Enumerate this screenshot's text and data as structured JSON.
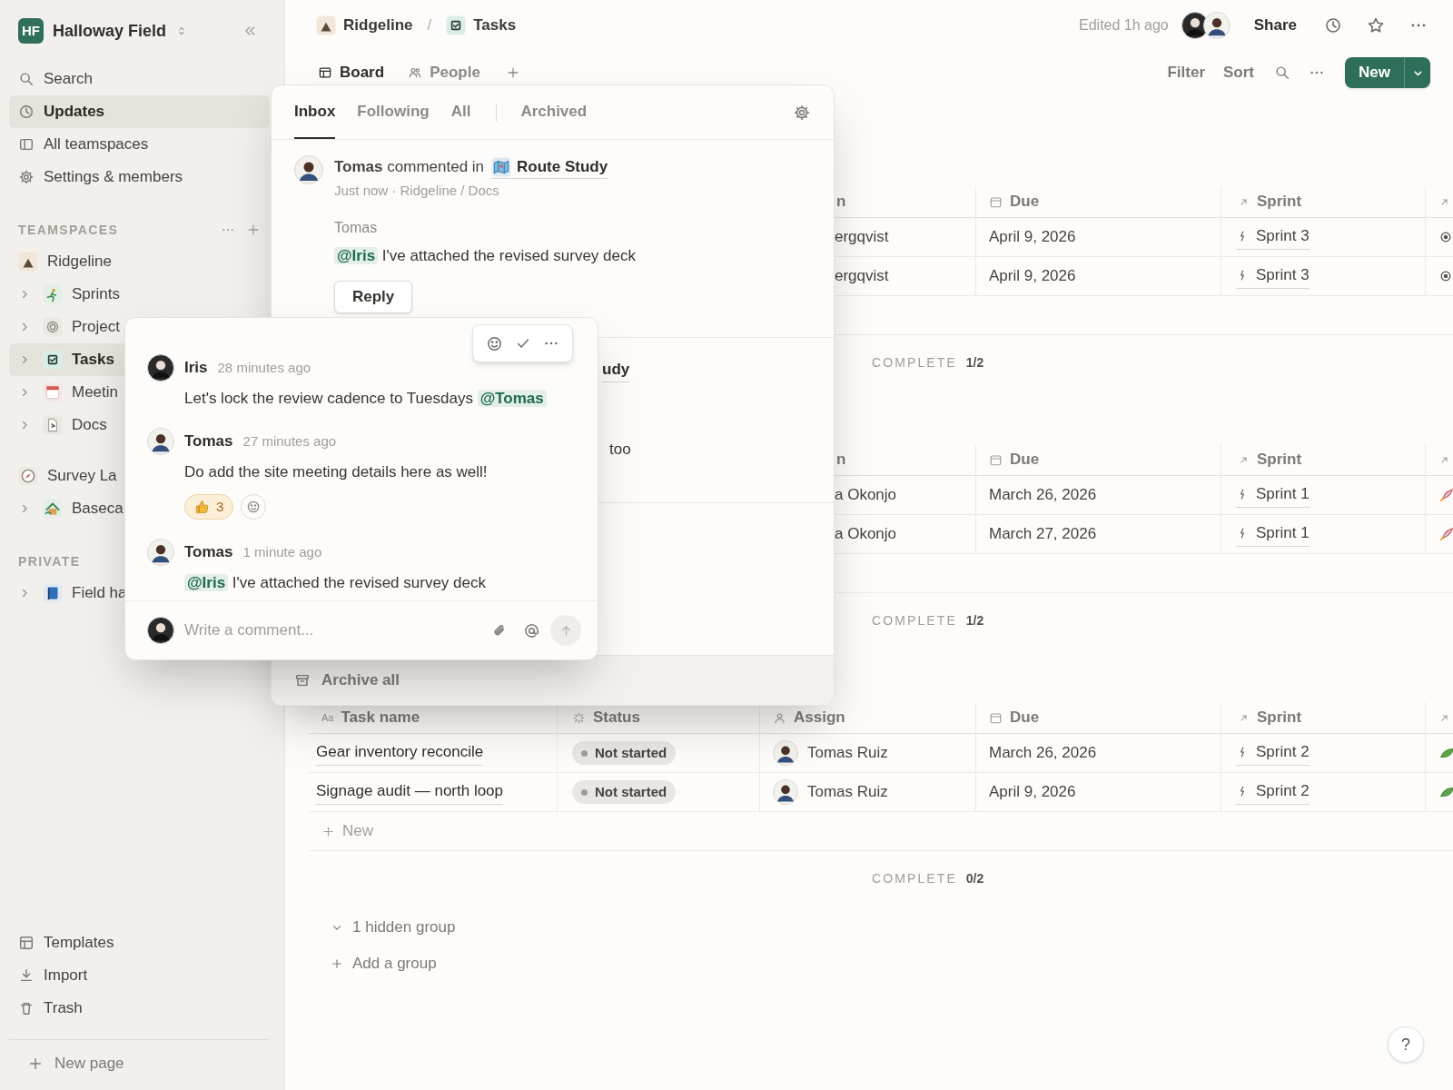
{
  "sidebar": {
    "workspace": {
      "initials": "HF",
      "name": "Halloway Field"
    },
    "nav": [
      {
        "label": "Search",
        "selected": false
      },
      {
        "label": "Updates",
        "selected": true
      },
      {
        "label": "All teamspaces",
        "selected": false
      },
      {
        "label": "Settings & members",
        "selected": false
      }
    ],
    "teamspaces_heading": "TEAMSPACES",
    "teamspaces": [
      {
        "label": "Ridgeline",
        "selected": false,
        "children": [
          {
            "label": "Sprints",
            "selected": false,
            "expanded": false
          },
          {
            "label": "Project",
            "selected": false,
            "expanded": false
          },
          {
            "label": "Tasks",
            "selected": true,
            "expanded": false
          },
          {
            "label": "Meetin",
            "selected": false,
            "expanded": false
          },
          {
            "label": "Docs",
            "selected": false,
            "expanded": false
          }
        ]
      },
      {
        "label": "Survey La",
        "selected": false,
        "children": [
          {
            "label": "Baseca",
            "selected": false,
            "expanded": false
          }
        ]
      }
    ],
    "private_heading": "PRIVATE",
    "private": [
      {
        "label": "Field ha",
        "selected": false,
        "expanded": false
      }
    ],
    "footer": [
      {
        "label": "Templates"
      },
      {
        "label": "Import"
      },
      {
        "label": "Trash"
      }
    ],
    "new_page": "New page"
  },
  "header": {
    "breadcrumb": [
      {
        "label": "Ridgeline"
      },
      {
        "label": "Tasks"
      }
    ],
    "separator": "/",
    "edited": "Edited 1h ago",
    "share": "Share"
  },
  "views": {
    "tabs": [
      {
        "label": "Board",
        "selected": true
      },
      {
        "label": "People",
        "selected": false
      }
    ],
    "filter": "Filter",
    "sort": "Sort",
    "new_button": "New"
  },
  "inbox": {
    "tabs": [
      {
        "label": "Inbox",
        "selected": true
      },
      {
        "label": "Following",
        "selected": false
      },
      {
        "label": "All",
        "selected": false
      },
      {
        "label": "Archived",
        "selected": false
      }
    ],
    "notification": {
      "actor": "Tomas",
      "action": "commented in",
      "page": "Route Study",
      "meta": "Just now · Ridgeline / Docs",
      "quote_author": "Tomas",
      "quote": [
        {
          "kind": "mention",
          "text": "@Iris"
        },
        {
          "kind": "text",
          "text": "I've attached the revised survey deck"
        }
      ],
      "reply": "Reply"
    },
    "partial_notification": {
      "title_fragment": "udy",
      "text_fragment": "too"
    },
    "archive_all": "Archive all"
  },
  "comment_popup": {
    "comments": [
      {
        "author": "Iris",
        "time": "28 minutes ago",
        "hovered": true,
        "parts": [
          {
            "kind": "text",
            "text": "Let's lock the review cadence to Tuesdays"
          },
          {
            "kind": "mention",
            "text": "@Tomas"
          }
        ]
      },
      {
        "author": "Tomas",
        "time": "27 minutes ago",
        "hovered": false,
        "parts": [
          {
            "kind": "text",
            "text": "Do add the site meeting details here as well!"
          }
        ],
        "reactions": [
          {
            "count": "3",
            "selected": true
          }
        ]
      },
      {
        "author": "Tomas",
        "time": "1 minute ago",
        "hovered": false,
        "parts": [
          {
            "kind": "mention",
            "text": "@Iris"
          },
          {
            "kind": "text",
            "text": "I've attached the revised survey deck"
          }
        ]
      }
    ],
    "composer_placeholder": "Write a comment..."
  },
  "board": {
    "groups": [
      {
        "kind": "partial",
        "columns": [
          "n",
          "Due",
          "Sprint"
        ],
        "rows": [
          {
            "assign": "ergqvist",
            "due": "April 9, 2026",
            "sprint": "Sprint 3"
          },
          {
            "assign": "ergqvist",
            "due": "April 9, 2026",
            "sprint": "Sprint 3"
          }
        ],
        "footer_label": "COMPLETE",
        "footer_value": "1/2"
      },
      {
        "kind": "partial",
        "columns": [
          "n",
          "Due",
          "Sprint"
        ],
        "rows": [
          {
            "assign": "a Okonjo",
            "due": "March 26, 2026",
            "sprint": "Sprint 1"
          },
          {
            "assign": "a Okonjo",
            "due": "March 27, 2026",
            "sprint": "Sprint 1"
          }
        ],
        "footer_label": "COMPLETE",
        "footer_value": "1/2"
      },
      {
        "kind": "full",
        "task_icon_text": "Aa",
        "columns": [
          "Task name",
          "Status",
          "Assign",
          "Due",
          "Sprint"
        ],
        "rows": [
          {
            "task": "Gear inventory reconcile",
            "status": "Not started",
            "assign": "Tomas Ruiz",
            "due": "March 26, 2026",
            "sprint": "Sprint 2"
          },
          {
            "task": "Signage audit — north loop",
            "status": "Not started",
            "assign": "Tomas Ruiz",
            "due": "April 9, 2026",
            "sprint": "Sprint 2"
          }
        ],
        "new_row": "New",
        "footer_label": "COMPLETE",
        "footer_value": "0/2"
      }
    ],
    "hidden_groups": "1 hidden group",
    "add_group": "Add a group"
  },
  "help": "?"
}
